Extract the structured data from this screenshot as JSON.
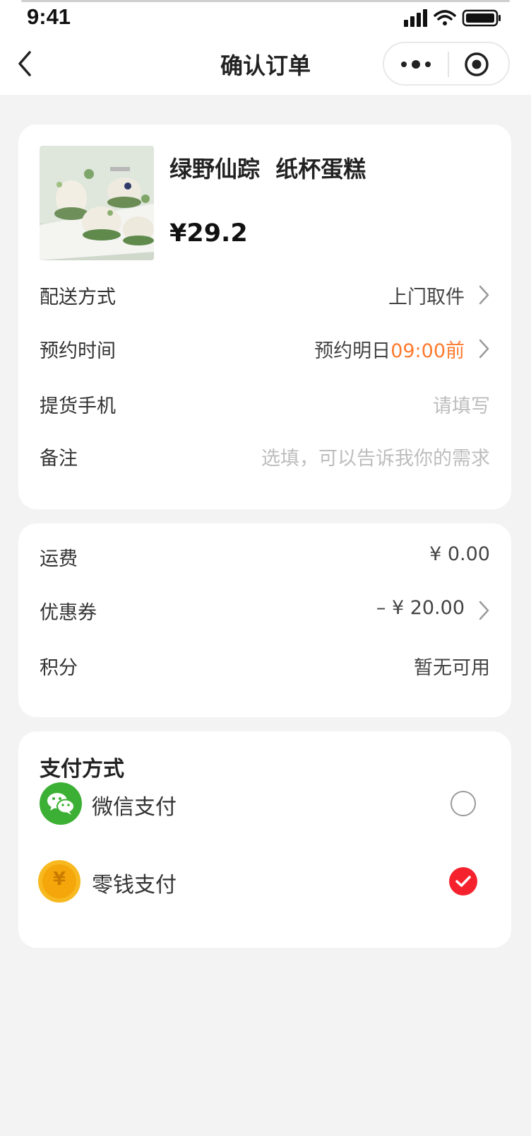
{
  "status_bar": {
    "time": "9:41"
  },
  "nav": {
    "title": "确认订单"
  },
  "product": {
    "name": "绿野仙踪  纸杯蛋糕",
    "price": "¥29.2",
    "thumb_icon": "cupcake-photo"
  },
  "order_rows": [
    {
      "label": "配送方式",
      "value": "上门取件"
    },
    {
      "label": "预约时间",
      "value_prefix": "预约明日",
      "value_highlight": "09:00前"
    },
    {
      "label": "提货手机",
      "placeholder": "请填写"
    },
    {
      "label": "备注",
      "placeholder": "选填，可以告诉我你的需求"
    }
  ],
  "fees": [
    {
      "label": "运费",
      "value": "¥ 0.00"
    },
    {
      "label": "优惠券",
      "value": "– ¥ 20.00"
    },
    {
      "label": "积分",
      "value": "暂无可用"
    }
  ],
  "payment": {
    "title": "支付方式",
    "options": [
      {
        "label": "微信支付",
        "icon": "wechat-icon",
        "selected": false
      },
      {
        "label": "零钱支付",
        "icon": "coin-icon",
        "coin_glyph": "¥",
        "selected": true
      }
    ]
  },
  "colors": {
    "accent_orange": "#ff7a2e",
    "selected_red": "#f5222d",
    "wechat_green": "#3cb034",
    "coin_gold": "#f7b91f",
    "page_bg": "#f3f3f3"
  }
}
